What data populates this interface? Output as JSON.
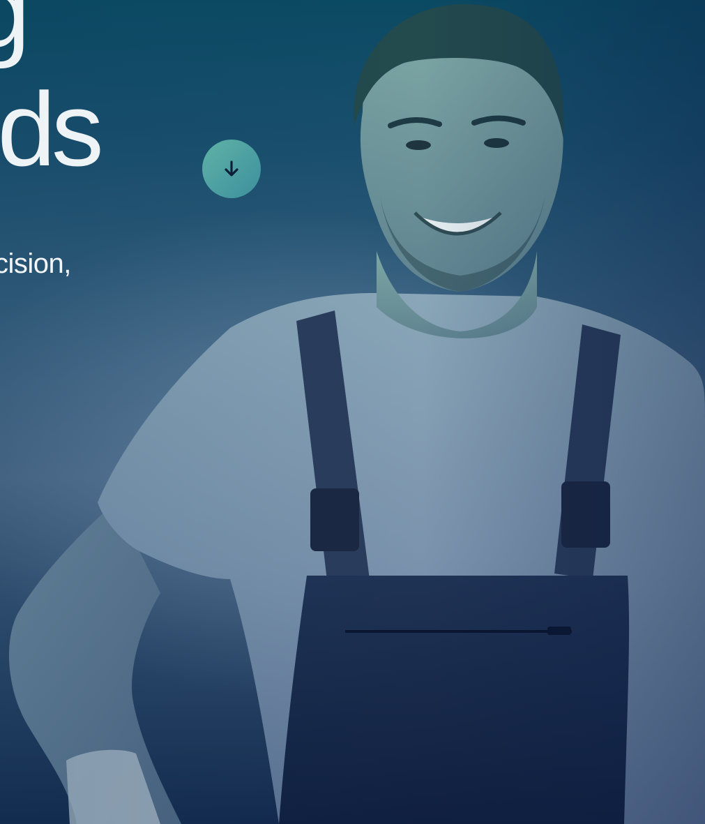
{
  "hero": {
    "headline_line_1": "g",
    "headline_line_2": "ards",
    "subtitle": "cision,",
    "scroll_button_icon": "arrow-down-icon"
  },
  "colors": {
    "background_top": "#0b4a63",
    "background_bottom": "#13294d",
    "accent": "#4fa39f",
    "text": "#eef3f6"
  }
}
